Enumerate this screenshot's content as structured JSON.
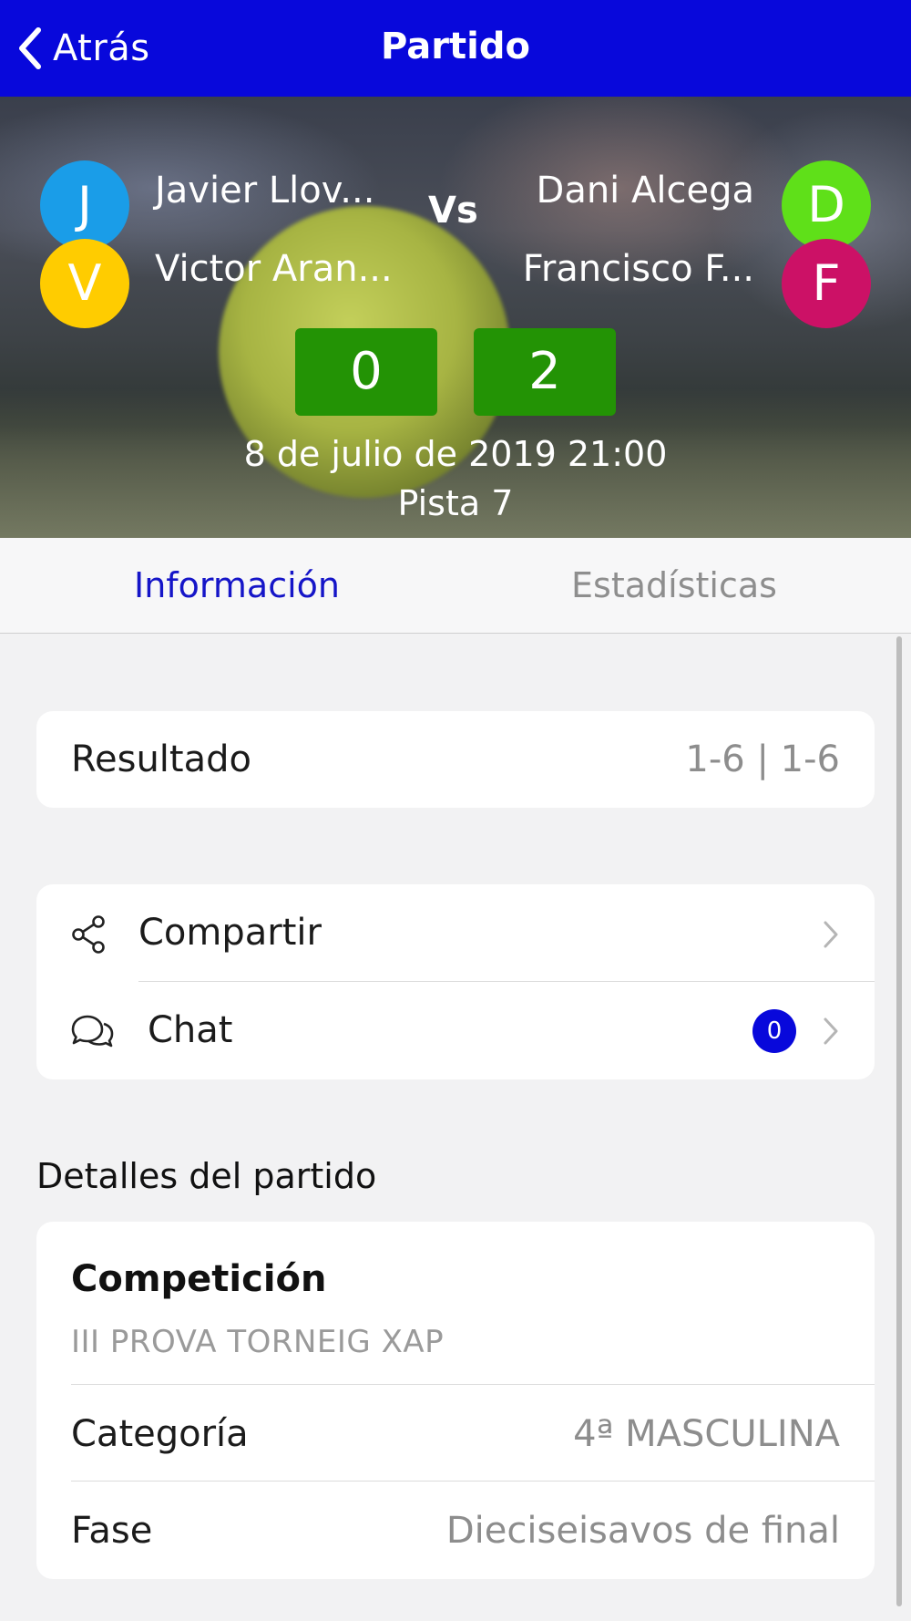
{
  "navbar": {
    "back_label": "Atrás",
    "title": "Partido"
  },
  "match": {
    "team1": [
      {
        "initial": "J",
        "name": "Javier Llov...",
        "color": "#1a9de8"
      },
      {
        "initial": "V",
        "name": "Victor Aran...",
        "color": "#ffcc00"
      }
    ],
    "vs": "Vs",
    "team2": [
      {
        "initial": "D",
        "name": "Dani Alcega",
        "color": "#5fe019"
      },
      {
        "initial": "F",
        "name": "Francisco F...",
        "color": "#cc1166"
      }
    ],
    "score1": "0",
    "score2": "2",
    "datetime": "8 de julio de 2019 21:00",
    "court": "Pista 7"
  },
  "tabs": {
    "info": "Información",
    "stats": "Estadísticas"
  },
  "result": {
    "label": "Resultado",
    "value": "1-6 | 1-6"
  },
  "actions": {
    "share_label": "Compartir",
    "chat_label": "Chat",
    "chat_count": "0"
  },
  "details": {
    "section_title": "Detalles del partido",
    "competition_label": "Competición",
    "competition_value": "III PROVA TORNEIG XAP",
    "category_label": "Categoría",
    "category_value": "4ª MASCULINA",
    "phase_label": "Fase",
    "phase_value": "Dieciseisavos de final"
  },
  "colors": {
    "accent": "#0808db",
    "score_bg": "#239305",
    "tab_active": "#1515c8"
  }
}
